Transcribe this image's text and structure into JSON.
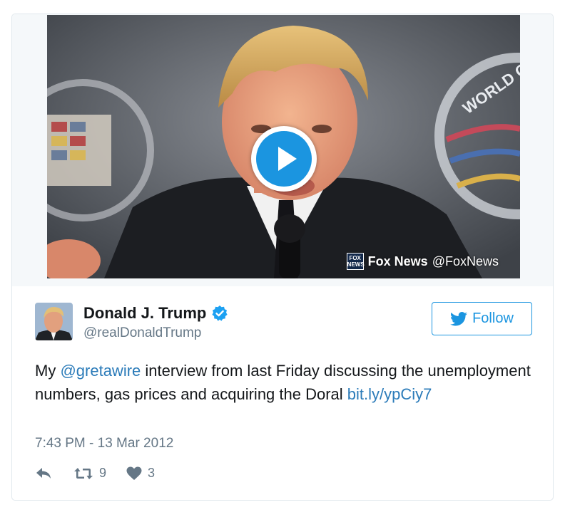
{
  "media": {
    "source_name": "Fox News",
    "source_handle": "@FoxNews",
    "logo_text_top": "FOX",
    "logo_text_bottom": "NEWS",
    "background_text": "WORLD G"
  },
  "author": {
    "display_name": "Donald J. Trump",
    "handle": "@realDonaldTrump",
    "verified": true
  },
  "follow_button": {
    "label": "Follow"
  },
  "tweet": {
    "text_before": "My ",
    "mention": "@gretawire",
    "text_after": " interview from last Friday discussing the unemployment numbers, gas prices and acquiring the Doral ",
    "link": "bit.ly/ypCiy7",
    "timestamp": "7:43 PM - 13 Mar 2012"
  },
  "actions": {
    "retweet_count": "9",
    "like_count": "3"
  },
  "colors": {
    "accent": "#1b95e0",
    "link": "#2b7bb9",
    "text": "#14171a",
    "muted": "#657786",
    "border": "#e1e8ed",
    "media_band": "#f5f8fa"
  },
  "icons": [
    "play-icon",
    "fox-news-logo",
    "verified-badge-icon",
    "twitter-bird-icon",
    "reply-icon",
    "retweet-icon",
    "heart-icon"
  ]
}
